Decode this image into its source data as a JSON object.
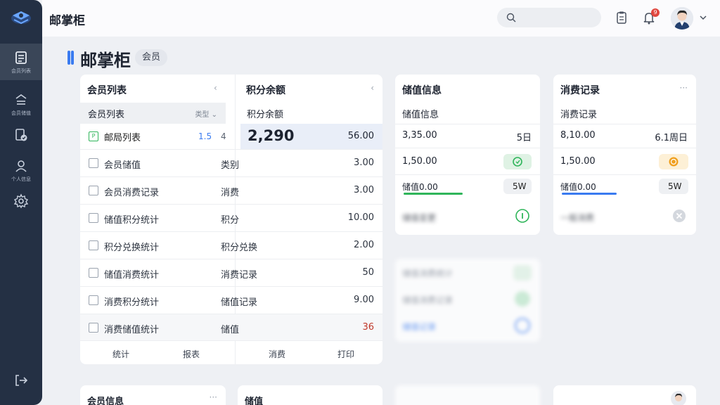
{
  "app": {
    "title": "邮掌柜"
  },
  "sidebar": {
    "items": [
      {
        "label": "会员列表",
        "icon": "list-icon"
      },
      {
        "label": "会员储值",
        "icon": "wallet-icon"
      },
      {
        "label": "",
        "icon": "shield-doc-icon"
      },
      {
        "label": "个人信息",
        "icon": "user-icon"
      },
      {
        "label": "",
        "icon": "gear-icon"
      }
    ]
  },
  "header": {
    "notifications": "9"
  },
  "page": {
    "title": "邮掌柜",
    "tag": "会员"
  },
  "member_card": {
    "title": "会员列表",
    "sub_title": "会员列表",
    "sub_filter": "类型",
    "highlight": {
      "label": "邮局列表",
      "v1": "1.5",
      "v2": "4"
    },
    "rows": [
      {
        "name": "会员储值",
        "type": "类别",
        "value": "3.00"
      },
      {
        "name": "会员消费记录",
        "type": "消费",
        "value": "3.00"
      },
      {
        "name": "储值积分统计",
        "type": "积分",
        "value": "10.00"
      },
      {
        "name": "积分兑换统计",
        "type": "积分兑换",
        "value": "2.00"
      },
      {
        "name": "储值消费统计",
        "type": "消费记录",
        "value": "50"
      },
      {
        "name": "消费积分统计",
        "type": "储值记录",
        "value": "9.00"
      },
      {
        "name": "消费储值统计",
        "type": "储值",
        "value": "36"
      }
    ],
    "footer": [
      "统计",
      "报表",
      "消费",
      "打印"
    ]
  },
  "points_card": {
    "title": "积分余额",
    "sub_title": "积分余额",
    "big_value": "2,290",
    "side_value": "56.00"
  },
  "storage_card": {
    "title": "储值信息",
    "sub_title": "储值信息",
    "r1_left": "3,35.00",
    "r1_right": "5日",
    "r2_left": "1,50.00",
    "r3_left": "储值0.00",
    "r3_right": "5W",
    "r4_left": "储值变更"
  },
  "consume_card": {
    "title": "消费记录",
    "sub_title": "消费记录",
    "r1_left": "8,10.00",
    "r1_right": "6.1周日",
    "r2_left": "1,50.00",
    "r3_left": "储值0.00",
    "r3_right": "5W",
    "r4_left": "一般消费"
  },
  "blurred_card": {
    "r1": "储值消费统计",
    "r2": "储值消费记录",
    "r3": "储值记录"
  },
  "bottom_cards": [
    "会员信息",
    "储值"
  ],
  "colors": {
    "accent": "#3a7bf0",
    "sidebar": "#243044",
    "green": "#2fb55a",
    "orange": "#f0a020"
  }
}
